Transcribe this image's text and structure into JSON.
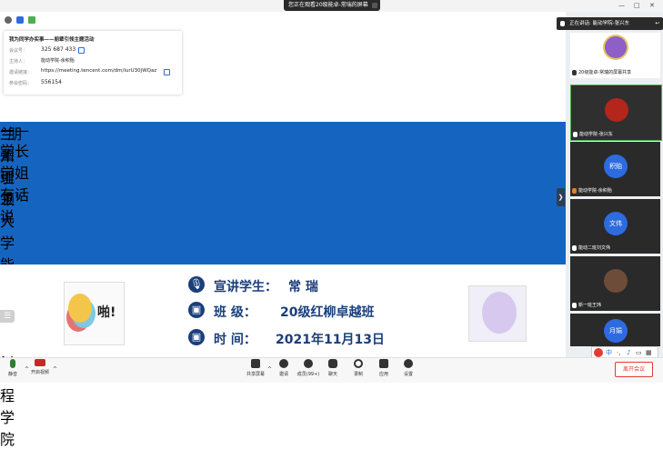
{
  "topbar": {
    "share_notice": "您正在观看20级能卓-常瑞的屏幕",
    "window_controls": [
      "—",
      "□",
      "✕"
    ]
  },
  "meeting_info": {
    "title": "我为同学办实事——朋辈引领主题活动",
    "rows": [
      {
        "label": "会议号：",
        "value": "325 687 433"
      },
      {
        "label": "主持人：",
        "value": "能动学院-余积贻"
      },
      {
        "label": "邀请链接：",
        "value": "https://meeting.tencent.com/dm/lurU30jWQaz"
      },
      {
        "label": "参会密码：",
        "value": "556154"
      }
    ]
  },
  "slide": {
    "title_line1": "“朋辈引领”",
    "title_line2": "——学长学姐有话说",
    "subtitle": "兰州理工大学能源与动力工程学院",
    "info": [
      {
        "label": "宣讲学生：",
        "value": "常 瑞",
        "icon": "microphone-icon"
      },
      {
        "label": "班  级：",
        "value": "20级红柳卓越班",
        "icon": "presenter-icon"
      },
      {
        "label": "时  间：",
        "value": "2021年11月13日",
        "icon": "presenter-icon"
      }
    ],
    "sticker_left_text": "啪!",
    "banner_color": "#1565c0",
    "info_color": "#1a3f7a"
  },
  "participants": {
    "speaking": "正在讲话: 能动学院-张兴东",
    "tiles": [
      {
        "name": "20级能卓-常瑞的屏幕共享",
        "avatar": "",
        "color": "#3a3a3a"
      },
      {
        "name": "能动学院-张兴东",
        "avatar": "",
        "color": "#b2261b"
      },
      {
        "name": "能动学院-余积贻",
        "avatar": "积贻",
        "color": "#2d6be0"
      },
      {
        "name": "能动二班刘文伟",
        "avatar": "文伟",
        "color": "#2d6be0"
      },
      {
        "name": "新一班王玮",
        "avatar": "",
        "color": "#6d4c3a"
      },
      {
        "name": "",
        "avatar": "月娟",
        "color": "#2d6be0"
      }
    ]
  },
  "ime": {
    "label": "中"
  },
  "toolbar": {
    "left": [
      {
        "label": "静音",
        "icon": "microphone-icon"
      },
      {
        "label": "开启视频",
        "icon": "camera-off-icon"
      }
    ],
    "center": [
      {
        "label": "共享屏幕",
        "icon": "share-screen-icon"
      },
      {
        "label": "邀请",
        "icon": "invite-icon"
      },
      {
        "label": "成员(99+)",
        "icon": "members-icon"
      },
      {
        "label": "聊天",
        "icon": "chat-icon"
      },
      {
        "label": "录制",
        "icon": "record-icon"
      },
      {
        "label": "应用",
        "icon": "apps-icon"
      },
      {
        "label": "设置",
        "icon": "settings-icon"
      }
    ],
    "leave": "离开会议"
  }
}
